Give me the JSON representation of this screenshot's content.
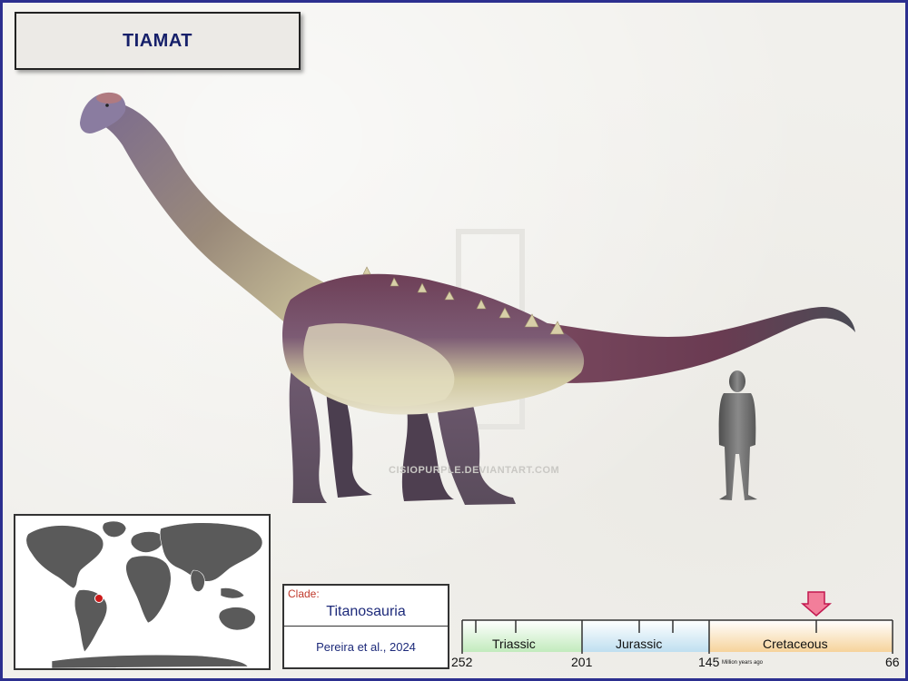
{
  "title": "TIAMAT",
  "watermark": "CISIOPURPLE.DEVIANTART.COM",
  "clade": {
    "label": "Clade:",
    "name": "Titanosauria",
    "reference": "Pereira et al., 2024"
  },
  "timeline": {
    "periods": [
      {
        "name": "Triassic",
        "color": "#cdeec9"
      },
      {
        "name": "Jurassic",
        "color": "#cfe6f3"
      },
      {
        "name": "Cretaceous",
        "color": "#f7d9a6"
      }
    ],
    "ticks": [
      "252",
      "201",
      "145",
      "66"
    ],
    "unit": "Million years ago",
    "marker_color": "#e8436a"
  },
  "map": {
    "land_color": "#5a5a5a",
    "ocean_color": "#ffffff",
    "locality_color": "#cc1a1a"
  },
  "colors": {
    "border": "#2c2f8f",
    "title_text": "#16206a"
  }
}
